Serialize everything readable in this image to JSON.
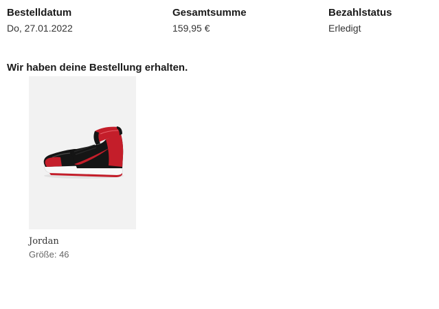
{
  "order_summary": {
    "date": {
      "label": "Bestelldatum",
      "value": "Do, 27.01.2022"
    },
    "total": {
      "label": "Gesamtsumme",
      "value": "159,95 €"
    },
    "payment": {
      "label": "Bezahlstatus",
      "value": "Erledigt"
    }
  },
  "message": "Wir haben deine Bestellung erhalten.",
  "items": [
    {
      "brand": "Jordan",
      "size": "Größe: 46",
      "image_icon": "sneaker-image"
    }
  ]
}
